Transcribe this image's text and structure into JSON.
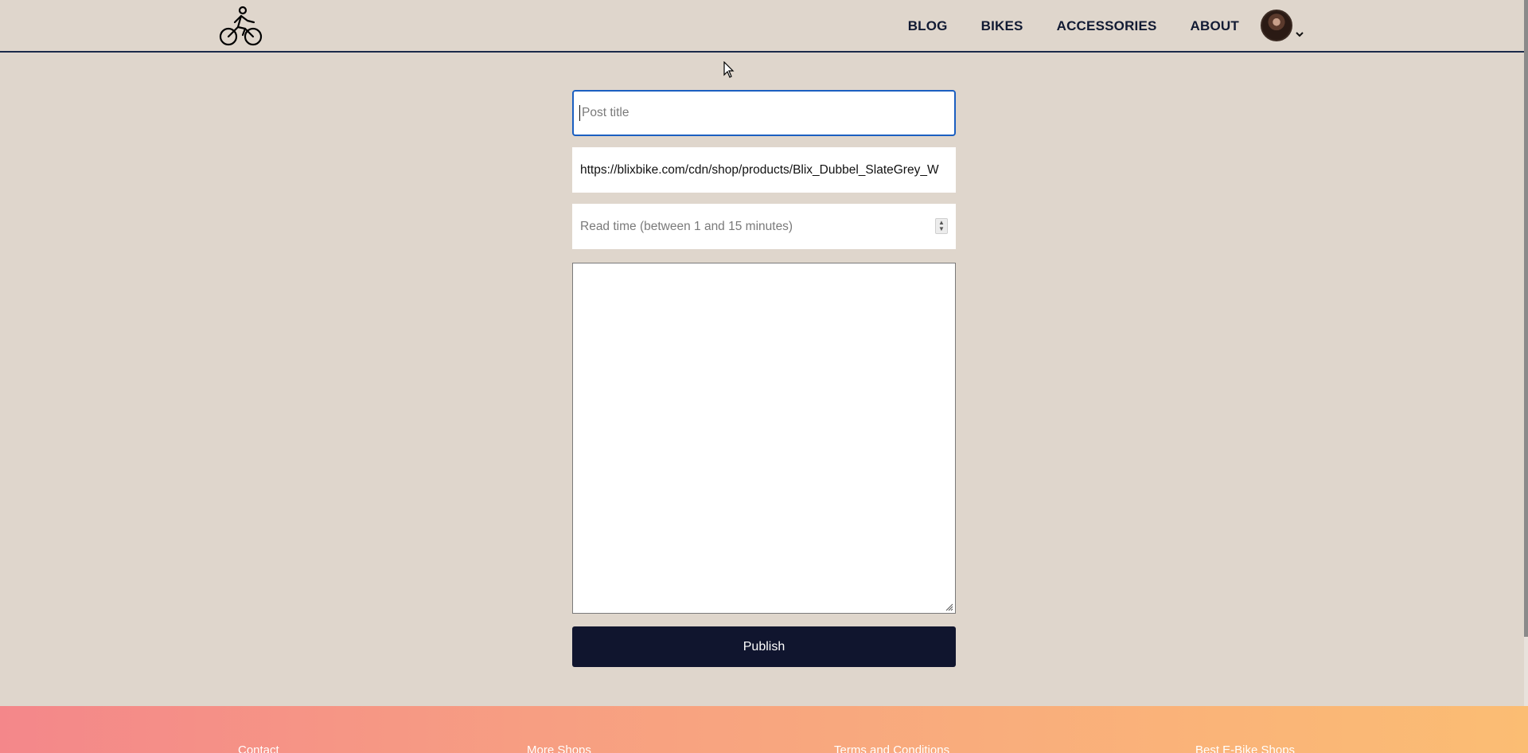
{
  "header": {
    "logo_icon": "cyclist-logo-icon",
    "nav": [
      {
        "label": "BLOG"
      },
      {
        "label": "BIKES"
      },
      {
        "label": "ACCESSORIES"
      },
      {
        "label": "ABOUT"
      }
    ],
    "avatar_icon": "user-avatar",
    "dropdown_icon": "chevron-down-icon"
  },
  "form": {
    "title_placeholder": "Post title",
    "title_value": "",
    "image_url_value": "https://blixbike.com/cdn/shop/products/Blix_Dubbel_SlateGrey_W",
    "read_time_placeholder": "Read time (between 1 and 15 minutes)",
    "content_value": "",
    "publish_label": "Publish"
  },
  "footer": {
    "links": [
      {
        "label": "Contact"
      },
      {
        "label": "More Shops"
      },
      {
        "label": "Terms and Conditions"
      },
      {
        "label": "Best E-Bike Shops"
      }
    ]
  },
  "colors": {
    "background": "#dfd6cc",
    "header_border": "#1a2a4a",
    "focus_border": "#1b5fc1",
    "button": "#10152e",
    "footer_start": "#f4878a",
    "footer_end": "#fbbd73"
  }
}
